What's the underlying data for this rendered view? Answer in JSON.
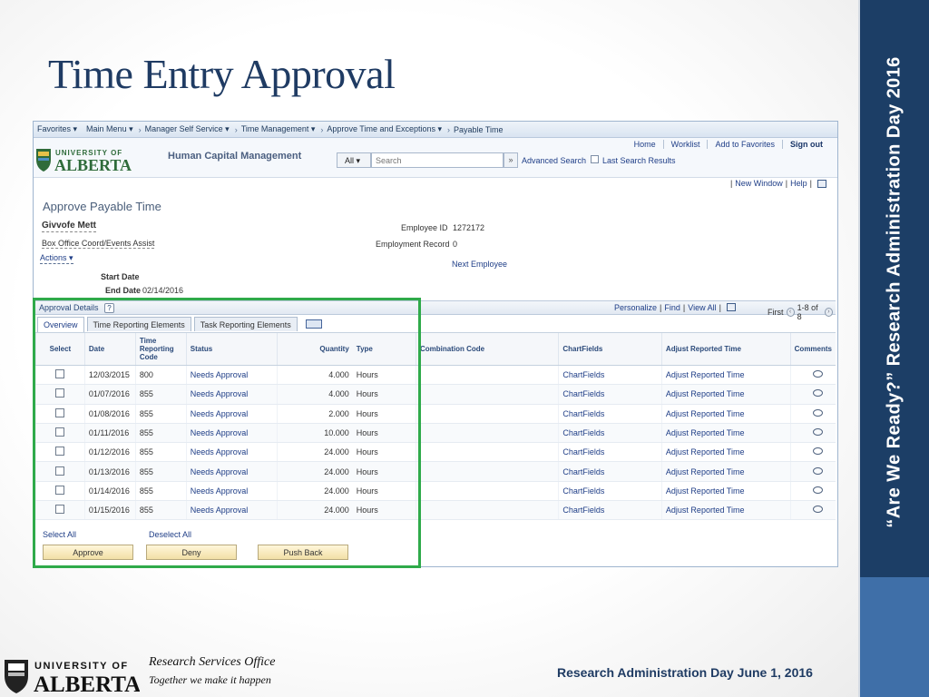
{
  "slide": {
    "title": "Time Entry Approval",
    "side_text": "“Are We Ready?” Research Administration Day 2016",
    "footer_office": "Research Services Office",
    "footer_tagline": "Together we make it happen",
    "footer_date": "Research Administration Day June 1, 2016",
    "logo_top": "UNIVERSITY OF",
    "logo_bottom": "ALBERTA"
  },
  "nav": {
    "favorites": "Favorites",
    "main_menu": "Main Menu",
    "manager_self_service": "Manager Self Service",
    "time_management": "Time Management",
    "approve_time": "Approve Time and Exceptions",
    "payable_time": "Payable Time"
  },
  "header": {
    "logo_top": "UNIVERSITY OF",
    "logo_bottom": "ALBERTA",
    "app_title": "Human Capital Management",
    "search_scope": "All",
    "search_placeholder": "Search",
    "advanced_search": "Advanced Search",
    "last_search_results": "Last Search Results",
    "links": {
      "home": "Home",
      "worklist": "Worklist",
      "add_to_favorites": "Add to Favorites",
      "sign_out": "Sign out"
    }
  },
  "util": {
    "new_window": "New Window",
    "help": "Help"
  },
  "page": {
    "title": "Approve Payable Time",
    "employee_name": "Givvofe Mett",
    "job_title": "Box Office Coord/Events Assist",
    "actions": "Actions",
    "employee_id_label": "Employee ID",
    "employee_id": "1272172",
    "employment_record_label": "Employment Record",
    "employment_record": "0",
    "next_employee": "Next Employee",
    "start_date_label": "Start Date",
    "start_date": "",
    "end_date_label": "End Date",
    "end_date": "02/14/2016"
  },
  "grid": {
    "title": "Approval Details",
    "help": "?",
    "personalize": "Personalize",
    "find": "Find",
    "view_all": "View All",
    "first": "First",
    "range": "1-8 of 8",
    "tabs": [
      "Overview",
      "Time Reporting Elements",
      "Task Reporting Elements"
    ],
    "columns": {
      "select": "Select",
      "date": "Date",
      "trc": "Time Reporting Code",
      "status": "Status",
      "quantity": "Quantity",
      "type": "Type",
      "combination_code": "Combination Code",
      "chartfields": "ChartFields",
      "adjust": "Adjust Reported Time",
      "comments": "Comments"
    },
    "rows": [
      {
        "date": "12/03/2015",
        "trc": "800",
        "status": "Needs Approval",
        "quantity": "4.000",
        "type": "Hours",
        "chartfields": "ChartFields",
        "adjust": "Adjust Reported Time"
      },
      {
        "date": "01/07/2016",
        "trc": "855",
        "status": "Needs Approval",
        "quantity": "4.000",
        "type": "Hours",
        "chartfields": "ChartFields",
        "adjust": "Adjust Reported Time"
      },
      {
        "date": "01/08/2016",
        "trc": "855",
        "status": "Needs Approval",
        "quantity": "2.000",
        "type": "Hours",
        "chartfields": "ChartFields",
        "adjust": "Adjust Reported Time"
      },
      {
        "date": "01/11/2016",
        "trc": "855",
        "status": "Needs Approval",
        "quantity": "10.000",
        "type": "Hours",
        "chartfields": "ChartFields",
        "adjust": "Adjust Reported Time"
      },
      {
        "date": "01/12/2016",
        "trc": "855",
        "status": "Needs Approval",
        "quantity": "24.000",
        "type": "Hours",
        "chartfields": "ChartFields",
        "adjust": "Adjust Reported Time"
      },
      {
        "date": "01/13/2016",
        "trc": "855",
        "status": "Needs Approval",
        "quantity": "24.000",
        "type": "Hours",
        "chartfields": "ChartFields",
        "adjust": "Adjust Reported Time"
      },
      {
        "date": "01/14/2016",
        "trc": "855",
        "status": "Needs Approval",
        "quantity": "24.000",
        "type": "Hours",
        "chartfields": "ChartFields",
        "adjust": "Adjust Reported Time"
      },
      {
        "date": "01/15/2016",
        "trc": "855",
        "status": "Needs Approval",
        "quantity": "24.000",
        "type": "Hours",
        "chartfields": "ChartFields",
        "adjust": "Adjust Reported Time"
      }
    ],
    "select_all": "Select All",
    "deselect_all": "Deselect All",
    "approve": "Approve",
    "deny": "Deny",
    "push_back": "Push Back"
  },
  "colors": {
    "title": "#1f3b63",
    "side_band": "#1c3e66",
    "highlight": "#2faa4a",
    "link": "#1f3e87"
  },
  "icons": [
    "comment-icon",
    "grid-icon",
    "help-icon",
    "university-shield-icon"
  ]
}
